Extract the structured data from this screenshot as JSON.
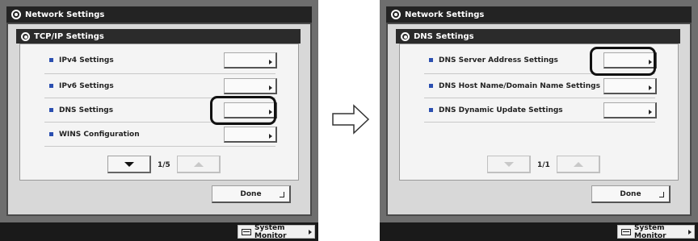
{
  "left": {
    "window_title": "Network Settings",
    "panel_title": "TCP/IP Settings",
    "items": [
      {
        "label": "IPv4 Settings"
      },
      {
        "label": "IPv6 Settings"
      },
      {
        "label": "DNS Settings",
        "highlighted": true
      },
      {
        "label": "WINS Configuration"
      }
    ],
    "page_indicator": "1/5",
    "done_label": "Done",
    "system_monitor_label": "System Monitor"
  },
  "right": {
    "window_title": "Network Settings",
    "panel_title": "DNS Settings",
    "items": [
      {
        "label": "DNS Server Address Settings",
        "highlighted": true
      },
      {
        "label": "DNS Host Name/Domain Name Settings"
      },
      {
        "label": "DNS Dynamic Update Settings"
      }
    ],
    "page_indicator": "1/1",
    "done_label": "Done",
    "system_monitor_label": "System Monitor"
  },
  "colors": {
    "bullet": "#2b4fb0",
    "title_bar": "#232323",
    "frame": "#d8d8d8"
  },
  "icons": {
    "title": "gear-icon",
    "row_button": "chevron-right-icon",
    "page_down": "triangle-down-icon",
    "page_up": "triangle-up-icon",
    "done": "return-arrow-icon",
    "system_monitor": "monitor-icon",
    "transition": "arrow-right-icon"
  }
}
